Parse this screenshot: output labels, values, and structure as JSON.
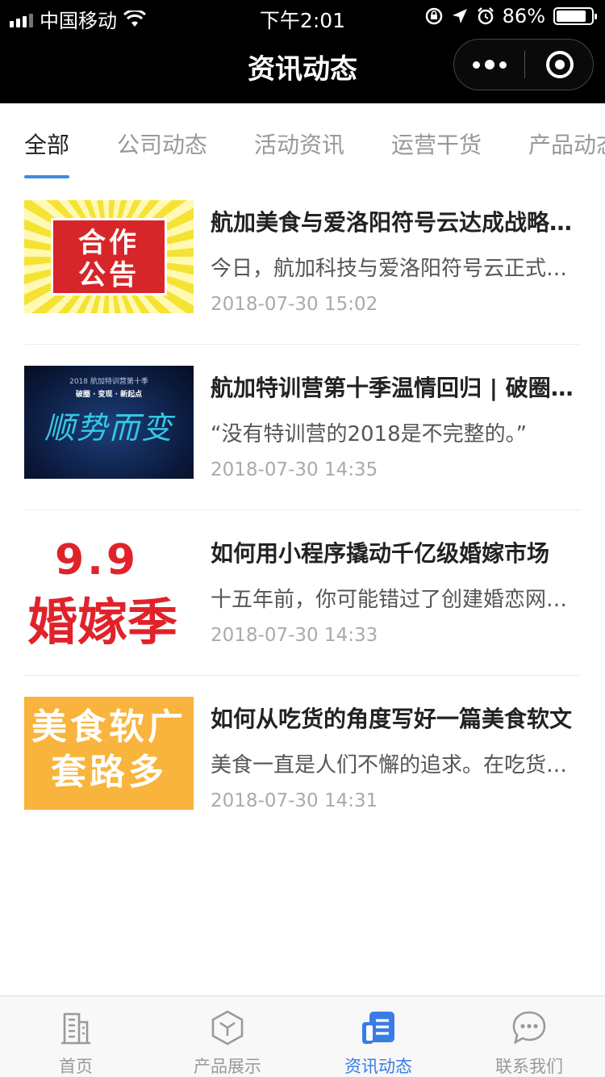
{
  "status_bar": {
    "carrier": "中国移动",
    "time": "下午2:01",
    "battery": "86%",
    "battery_level": 0.86
  },
  "nav": {
    "title": "资讯动态"
  },
  "tabs": [
    {
      "label": "全部",
      "active": true
    },
    {
      "label": "公司动态",
      "active": false
    },
    {
      "label": "活动资讯",
      "active": false
    },
    {
      "label": "运营干货",
      "active": false
    },
    {
      "label": "产品动态",
      "active": false
    }
  ],
  "articles": [
    {
      "title": "航加美食与爱洛阳符号云达成战略合作",
      "desc": "今日，航加科技与爱洛阳符号云正式达成合作",
      "date": "2018-07-30 15:02",
      "thumb_text": "合作\n公告"
    },
    {
      "title": "航加特训营第十季温情回归 | 破圈·变现·新起点",
      "desc": "“没有特训营的2018是不完整的。”",
      "date": "2018-07-30 14:35",
      "thumb_text_top": "2018 航加特训营第十季",
      "thumb_text_sub": "破圈 · 变现 · 新起点",
      "thumb_text_big": "顺势而变"
    },
    {
      "title": "如何用小程序撬动千亿级婚嫁市场",
      "desc": "十五年前，你可能错过了创建婚恋网站的机会",
      "date": "2018-07-30 14:33",
      "thumb_text_line1": "9.9",
      "thumb_text_line2": "婚嫁季"
    },
    {
      "title": "如何从吃货的角度写好一篇美食软文",
      "desc": "美食一直是人们不懈的追求。在吃货眼中",
      "date": "2018-07-30 14:31",
      "thumb_text": "美食软广\n套路多"
    }
  ],
  "tabbar": [
    {
      "label": "首页",
      "icon": "building-icon",
      "active": false
    },
    {
      "label": "产品展示",
      "icon": "box-icon",
      "active": false
    },
    {
      "label": "资讯动态",
      "icon": "news-icon",
      "active": true
    },
    {
      "label": "联系我们",
      "icon": "chat-icon",
      "active": false
    }
  ],
  "colors": {
    "accent": "#3a8ee6",
    "tabbar_active": "#3a7ce6",
    "tabbar_inactive": "#999999"
  }
}
